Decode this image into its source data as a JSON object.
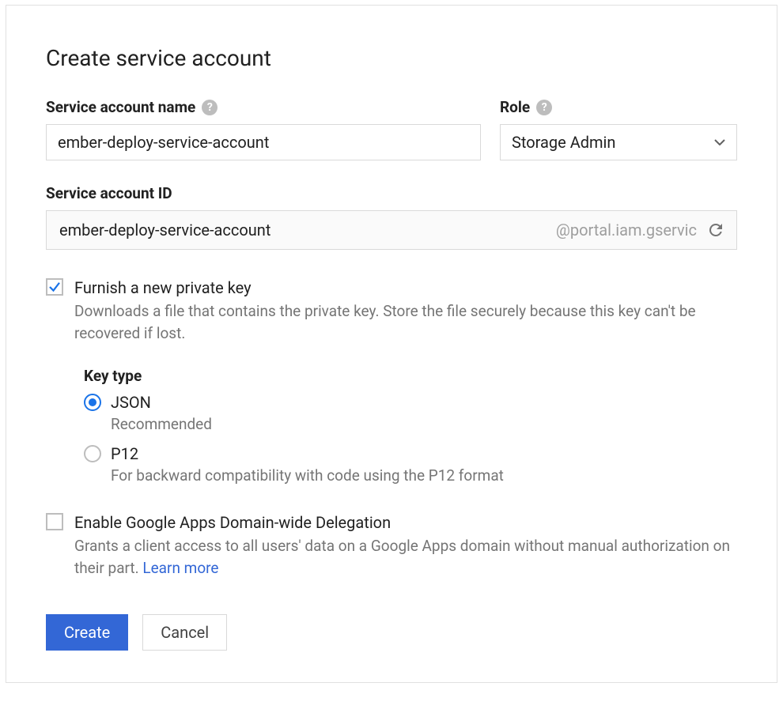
{
  "title": "Create service account",
  "name_field": {
    "label": "Service account name",
    "value": "ember-deploy-service-account"
  },
  "role_field": {
    "label": "Role",
    "value": "Storage Admin"
  },
  "id_field": {
    "label": "Service account ID",
    "value": "ember-deploy-service-account",
    "suffix": "@portal.iam.gservic"
  },
  "furnish_key": {
    "checked": true,
    "title": "Furnish a new private key",
    "desc": "Downloads a file that contains the private key. Store the file securely because this key can't be recovered if lost."
  },
  "key_type": {
    "label": "Key type",
    "options": [
      {
        "value": "json",
        "label": "JSON",
        "sub": "Recommended",
        "selected": true
      },
      {
        "value": "p12",
        "label": "P12",
        "sub": "For backward compatibility with code using the P12 format",
        "selected": false
      }
    ]
  },
  "delegation": {
    "checked": false,
    "title": "Enable Google Apps Domain-wide Delegation",
    "desc_prefix": "Grants a client access to all users' data on a Google Apps domain without manual authorization on their part. ",
    "learn_more": "Learn more"
  },
  "buttons": {
    "create": "Create",
    "cancel": "Cancel"
  }
}
